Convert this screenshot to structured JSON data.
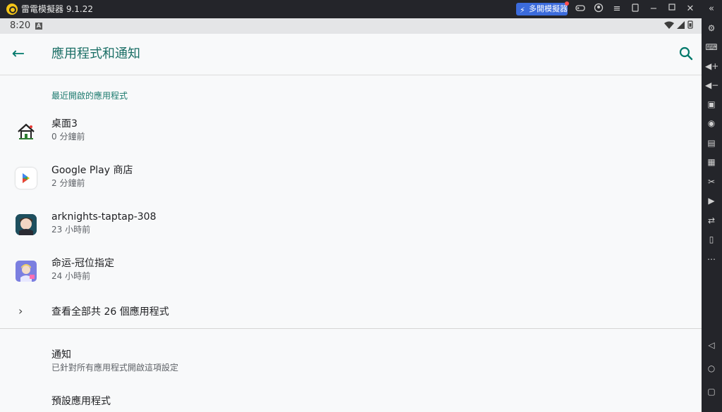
{
  "titlebar": {
    "title": "雷電模擬器 9.1.22",
    "multi_instance_label": "多開模擬器",
    "icons": [
      "gamepad-icon",
      "account-icon",
      "menu-icon",
      "screen-rotate-icon",
      "minimize-icon",
      "maximize-icon",
      "close-icon",
      "collapse-sidebar-icon"
    ]
  },
  "statusbar": {
    "time": "8:20",
    "notification_icon": "A",
    "wifi": "▼",
    "signal": "◢",
    "battery": "▮"
  },
  "appbar": {
    "title": "應用程式和通知",
    "back_icon": "←"
  },
  "recent": {
    "header": "最近開啟的應用程式",
    "items": [
      {
        "title": "桌面3",
        "subtitle": "0 分鐘前"
      },
      {
        "title": "Google Play 商店",
        "subtitle": "2 分鐘前"
      },
      {
        "title": "arknights-taptap-308",
        "subtitle": "23 小時前"
      },
      {
        "title": "命运-冠位指定",
        "subtitle": "24 小時前"
      }
    ],
    "see_all": "查看全部共 26 個應用程式"
  },
  "settings": [
    {
      "title": "通知",
      "subtitle": "已針對所有應用程式開啟這項設定"
    },
    {
      "title": "預設應用程式",
      "subtitle": ""
    }
  ],
  "sidebar": {
    "icons": [
      "settings-icon",
      "keyboard-icon",
      "volume-up-icon",
      "volume-down-icon",
      "screenshot-icon",
      "add-app-icon",
      "install-apk-icon",
      "keymap-icon",
      "scissors-icon",
      "record-icon",
      "sync-icon",
      "phone-icon",
      "more-icon",
      "android-back-icon",
      "android-home-icon",
      "android-recents-icon"
    ]
  },
  "colors": {
    "accent": "#00796b",
    "titlebar_bg": "#24252a",
    "multi_btn": "#3b6bdc"
  }
}
